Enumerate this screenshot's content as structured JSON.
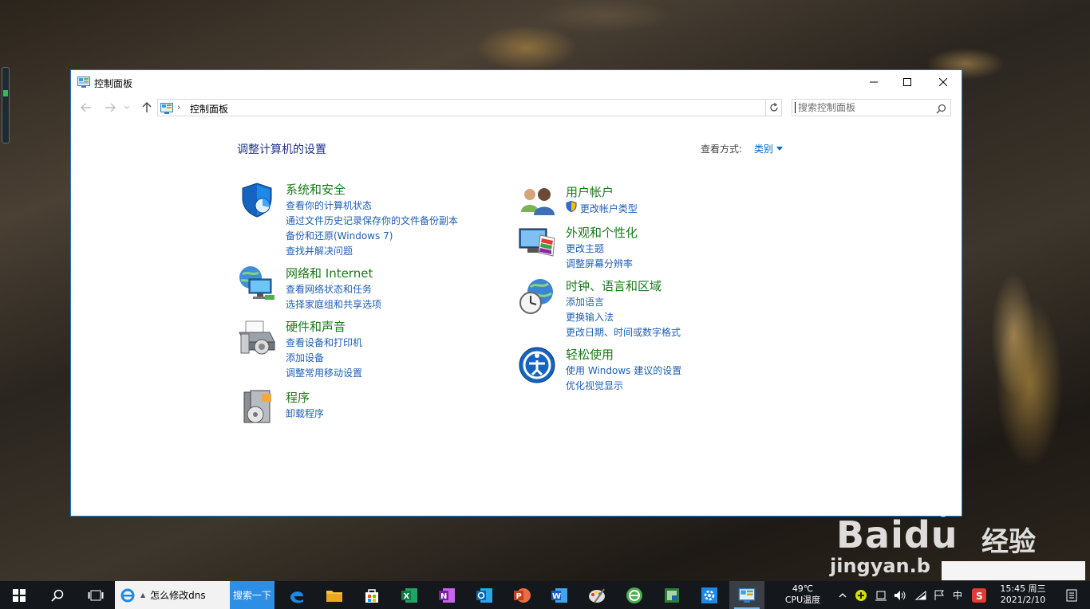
{
  "window": {
    "title": "控制面板",
    "breadcrumb": "控制面板",
    "search_placeholder": "搜索控制面板"
  },
  "content": {
    "heading": "调整计算机的设置",
    "view_by_label": "查看方式:",
    "view_by_value": "类别",
    "categories": [
      {
        "title": "系统和安全",
        "icon": "shield-icon",
        "links": [
          "查看你的计算机状态",
          "通过文件历史记录保存你的文件备份副本",
          "备份和还原(Windows 7)",
          "查找并解决问题"
        ]
      },
      {
        "title": "网络和 Internet",
        "icon": "network-icon",
        "links": [
          "查看网络状态和任务",
          "选择家庭组和共享选项"
        ]
      },
      {
        "title": "硬件和声音",
        "icon": "printer-icon",
        "links": [
          "查看设备和打印机",
          "添加设备",
          "调整常用移动设置"
        ]
      },
      {
        "title": "程序",
        "icon": "programs-icon",
        "links": [
          "卸载程序"
        ]
      },
      {
        "title": "用户帐户",
        "icon": "users-icon",
        "links": [
          "更改帐户类型"
        ]
      },
      {
        "title": "外观和个性化",
        "icon": "appearance-icon",
        "links": [
          "更改主题",
          "调整屏幕分辨率"
        ]
      },
      {
        "title": "时钟、语言和区域",
        "icon": "clock-globe-icon",
        "links": [
          "添加语言",
          "更换输入法",
          "更改日期、时间或数字格式"
        ]
      },
      {
        "title": "轻松使用",
        "icon": "ease-of-access-icon",
        "links": [
          "使用 Windows 建议的设置",
          "优化视觉显示"
        ]
      }
    ]
  },
  "taskbar": {
    "ie_text": "怎么修改dns",
    "search_button": "搜索一下",
    "cpu_temp": "49℃",
    "cpu_label": "CPU温度",
    "ime": "中",
    "time": "15:45 周三",
    "date": "2021/2/10"
  },
  "watermark": {
    "brand": "Baidu",
    "brand_cn": "经验",
    "url": "jingyan.b"
  },
  "colors": {
    "window_border": "#1f78c8",
    "heading": "#1e3287",
    "category_title": "#1a7a1a",
    "link": "#1e5fb4",
    "taskbar": "#14171b",
    "search_button": "#2d8ee6"
  }
}
